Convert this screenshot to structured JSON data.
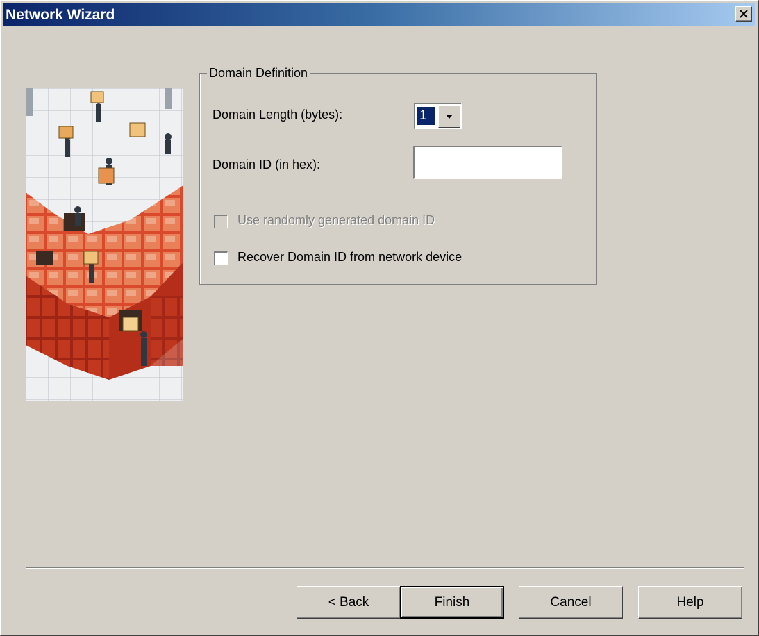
{
  "window": {
    "title": "Network Wizard"
  },
  "group": {
    "title": "Domain Definition",
    "domain_length_label": "Domain Length (bytes):",
    "domain_length_value": "1",
    "domain_id_label": "Domain ID (in hex):",
    "domain_id_value": "",
    "random_id_label": "Use randomly generated domain ID",
    "random_id_checked": false,
    "random_id_enabled": false,
    "recover_label": "Recover Domain ID from network device",
    "recover_checked": false
  },
  "buttons": {
    "back": "< Back",
    "finish": "Finish",
    "cancel": "Cancel",
    "help": "Help"
  },
  "icons": {
    "close": "close-icon",
    "dropdown": "chevron-down-icon"
  },
  "colors": {
    "dialog_bg": "#d4d0c8",
    "titlebar_start": "#0a246a",
    "titlebar_end": "#a6caf0",
    "selection": "#0a246a"
  }
}
